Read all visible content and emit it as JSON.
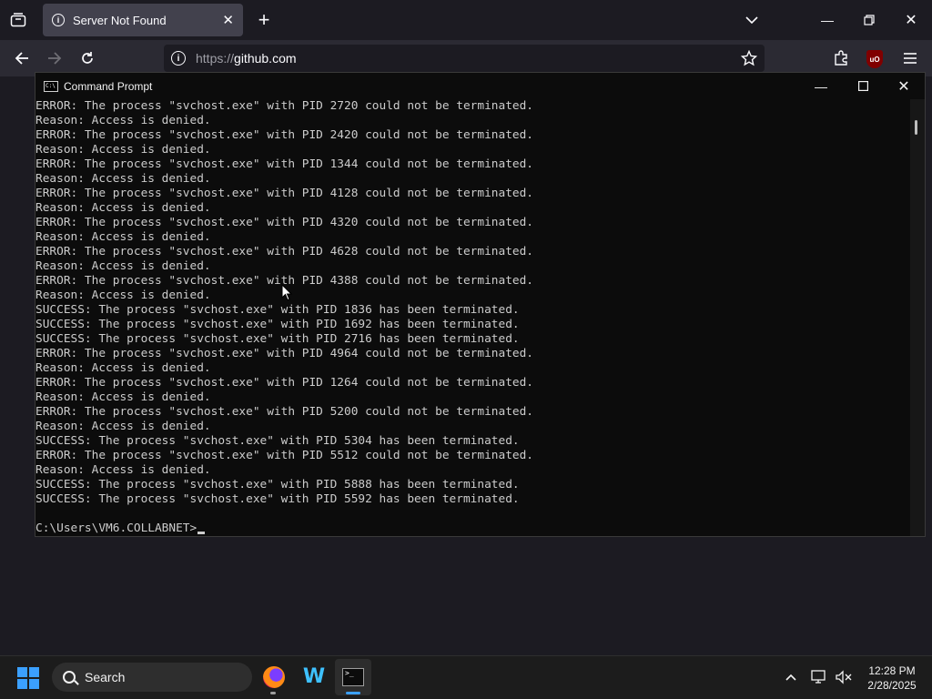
{
  "browser": {
    "tab_title": "Server Not Found",
    "url_prefix": "https://",
    "url_host": "github.com"
  },
  "cmd": {
    "title": "Command Prompt",
    "lines": [
      "ERROR: The process \"svchost.exe\" with PID 2720 could not be terminated.",
      "Reason: Access is denied.",
      "ERROR: The process \"svchost.exe\" with PID 2420 could not be terminated.",
      "Reason: Access is denied.",
      "ERROR: The process \"svchost.exe\" with PID 1344 could not be terminated.",
      "Reason: Access is denied.",
      "ERROR: The process \"svchost.exe\" with PID 4128 could not be terminated.",
      "Reason: Access is denied.",
      "ERROR: The process \"svchost.exe\" with PID 4320 could not be terminated.",
      "Reason: Access is denied.",
      "ERROR: The process \"svchost.exe\" with PID 4628 could not be terminated.",
      "Reason: Access is denied.",
      "ERROR: The process \"svchost.exe\" with PID 4388 could not be terminated.",
      "Reason: Access is denied.",
      "SUCCESS: The process \"svchost.exe\" with PID 1836 has been terminated.",
      "SUCCESS: The process \"svchost.exe\" with PID 1692 has been terminated.",
      "SUCCESS: The process \"svchost.exe\" with PID 2716 has been terminated.",
      "ERROR: The process \"svchost.exe\" with PID 4964 could not be terminated.",
      "Reason: Access is denied.",
      "ERROR: The process \"svchost.exe\" with PID 1264 could not be terminated.",
      "Reason: Access is denied.",
      "ERROR: The process \"svchost.exe\" with PID 5200 could not be terminated.",
      "Reason: Access is denied.",
      "SUCCESS: The process \"svchost.exe\" with PID 5304 has been terminated.",
      "ERROR: The process \"svchost.exe\" with PID 5512 could not be terminated.",
      "Reason: Access is denied.",
      "SUCCESS: The process \"svchost.exe\" with PID 5888 has been terminated.",
      "SUCCESS: The process \"svchost.exe\" with PID 5592 has been terminated.",
      ""
    ],
    "prompt": "C:\\Users\\VM6.COLLABNET>"
  },
  "taskbar": {
    "search_label": "Search",
    "time": "12:28 PM",
    "date": "2/28/2025"
  },
  "icons": {
    "tab_overview": "tab-overview-icon",
    "new_tab": "plus-icon",
    "list_tabs": "chevron-down-icon",
    "back": "back-arrow-icon",
    "forward": "forward-arrow-icon",
    "reload": "reload-icon",
    "bookmark": "star-icon",
    "extensions": "puzzle-icon",
    "ublock": "ublock-origin-icon",
    "menu": "hamburger-menu-icon"
  },
  "colors": {
    "accent": "#3ba0ff",
    "console_text": "#cccccc",
    "console_bg": "#0c0c0c"
  }
}
